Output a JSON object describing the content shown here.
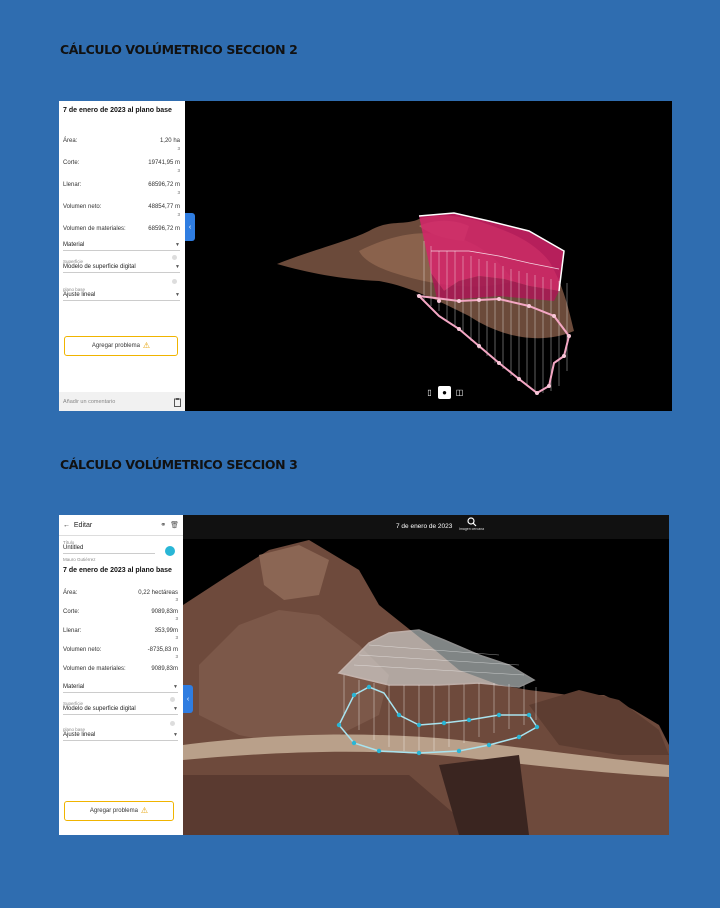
{
  "section2": {
    "title": "CÁLCULO VOLÚMETRICO SECCION 2",
    "panel": {
      "heading": "7 de enero de 2023 al plano base",
      "metrics": [
        {
          "label": "Área:",
          "value": "1,20 ha",
          "sup": ""
        },
        {
          "label": "Corte:",
          "value": "19741,95 m",
          "sup": "3"
        },
        {
          "label": "Llenar:",
          "value": "68596,72 m",
          "sup": "3"
        },
        {
          "label": "Volumen neto:",
          "value": "48854,77 m",
          "sup": "3"
        },
        {
          "label": "Volumen de materiales:",
          "value": "68596,72 m",
          "sup": "3"
        }
      ],
      "material_label": "Material",
      "surface_hint": "Superficie",
      "surface_value": "Modelo de superficie digital",
      "base_hint": "plano base",
      "base_value": "Ajuste lineal",
      "problem_button": "Agregar problema",
      "comment_placeholder": "Añadir un comentario"
    },
    "view_toggle": [
      "map-icon",
      "3d-icon",
      "split-icon"
    ]
  },
  "section3": {
    "title": "CÁLCULO VOLÚMETRICO SECCION 3",
    "panel": {
      "back_label": "Editar",
      "title_hint": "Título",
      "title_value": "Untitled",
      "author": "Mauro Gutiérrez",
      "heading": "7 de enero de 2023 al plano base",
      "metrics": [
        {
          "label": "Área:",
          "value": "0,22 hectáreas",
          "sup": ""
        },
        {
          "label": "Corte:",
          "value": "9089,83m",
          "sup": "3"
        },
        {
          "label": "Llenar:",
          "value": "353,99m",
          "sup": "3"
        },
        {
          "label": "Volumen neto:",
          "value": "-8735,83 m",
          "sup": "3"
        },
        {
          "label": "Volumen de materiales:",
          "value": "9089,83m",
          "sup": "3"
        }
      ],
      "material_label": "Material",
      "surface_hint": "Superficie",
      "surface_value": "Modelo de superficie digital",
      "base_hint": "plano base",
      "base_value": "Ajuste lineal",
      "problem_button": "Agregar problema"
    },
    "topbar_date": "7 de enero de 2023",
    "topbar_search": "Imagen cercana",
    "accent_color": "#29b6d6"
  },
  "colors": {
    "page_bg": "#2f6db0",
    "fill_pink": "#d6246b",
    "warning": "#f0b400",
    "tab_blue": "#2f7de1"
  }
}
